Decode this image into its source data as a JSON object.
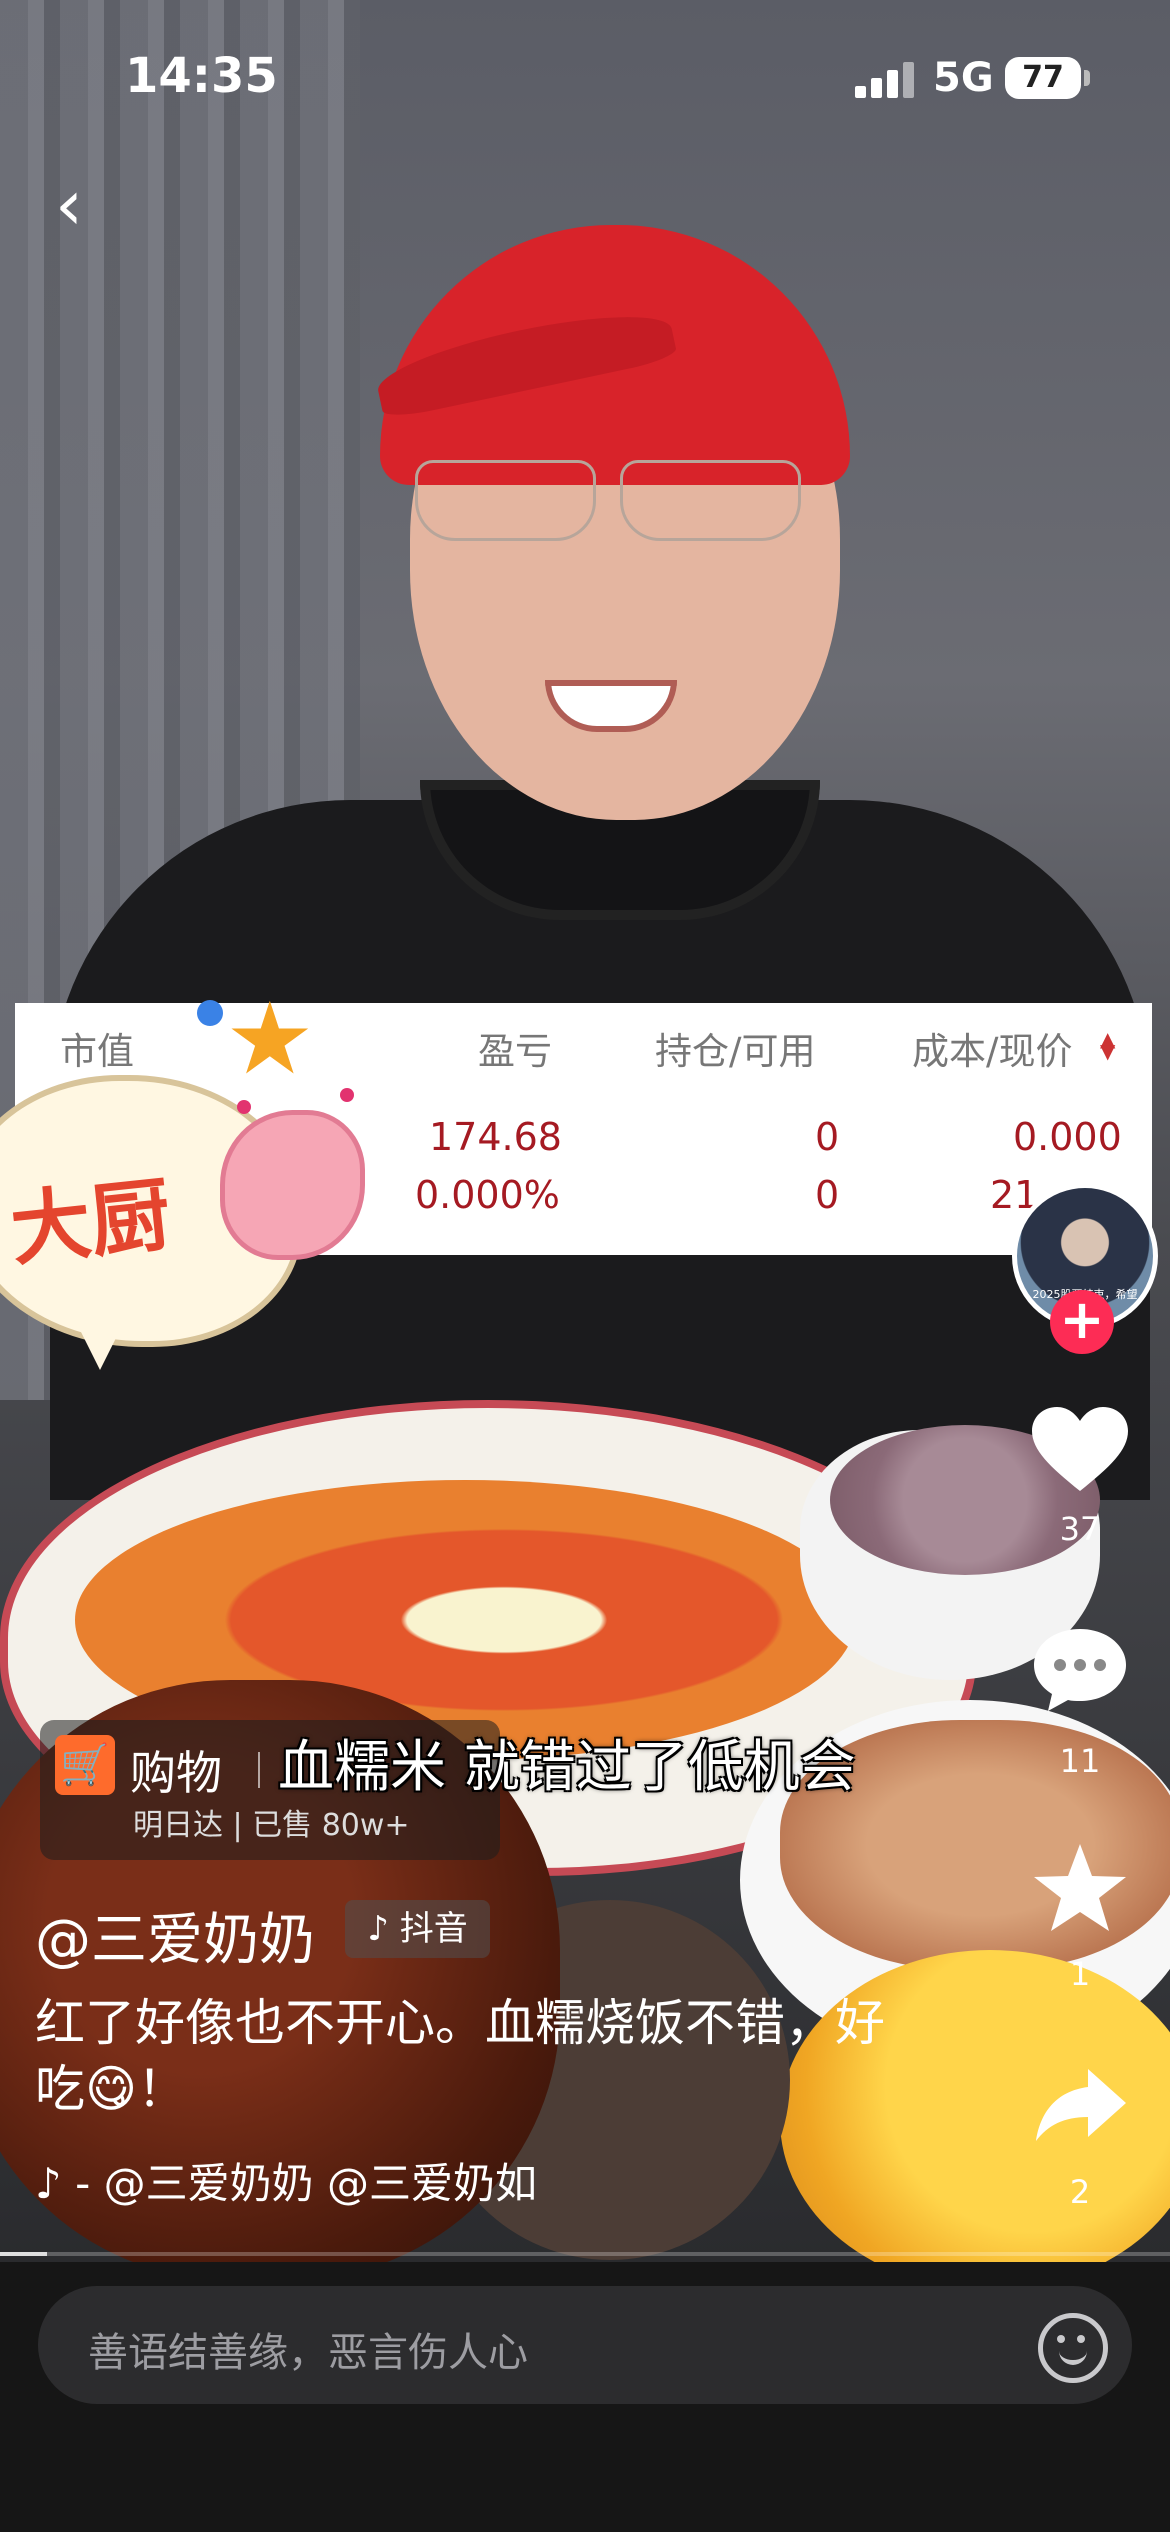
{
  "status_bar": {
    "time": "14:35",
    "network": "5G",
    "battery": "77"
  },
  "stock_overlay": {
    "headers": [
      "市值",
      "盈亏",
      "持仓/可用",
      "成本/现价"
    ],
    "profit_amount": "174.68",
    "profit_percent": "0.000%",
    "position": "0",
    "available": "0",
    "cost": "0.000",
    "price_partial": "21"
  },
  "sticker": {
    "text": "大厨"
  },
  "right_rail": {
    "avatar_text": "2025股票结束，希望",
    "likes": "37",
    "comments": "11",
    "favorites": "1",
    "shares": "2"
  },
  "shop": {
    "title": "购物",
    "subtitle": "明日达 | 已售 80w+"
  },
  "video_subtitle": "血糯米 就错过了低机会",
  "author": {
    "name": "@三爱奶奶",
    "badge": "抖音"
  },
  "description": "红了好像也不开心。血糯烧饭不错，好吃😋！",
  "music": "- @三爱奶奶    @三爱奶如",
  "comment_bar": {
    "placeholder": "善语结善缘，恶言伤人心"
  },
  "playback": {
    "progress_fraction": 0.04
  },
  "colors": {
    "like_red": "#fd2c55",
    "shop_orange": "#fe6b2c",
    "stock_red": "#a51a22"
  }
}
